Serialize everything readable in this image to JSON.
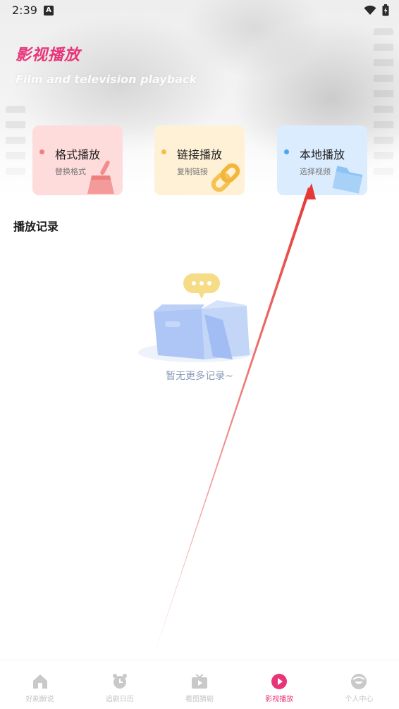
{
  "status_bar": {
    "time": "2:39",
    "notification_icon": "a-letter-icon",
    "wifi_icon": "wifi-icon",
    "battery_icon": "battery-charging-icon"
  },
  "header": {
    "title": "影视播放",
    "subtitle": "Film and television playback",
    "title_color": "#e8357a"
  },
  "cards": [
    {
      "title": "格式播放",
      "subtitle": "替换格式",
      "icon": "broom-icon",
      "bg": "#ffdcdc",
      "accent": "#f07f7f"
    },
    {
      "title": "链接播放",
      "subtitle": "复制链接",
      "icon": "chain-link-icon",
      "bg": "#fff1d6",
      "accent": "#f3bf4a"
    },
    {
      "title": "本地播放",
      "subtitle": "选择视频",
      "icon": "folder-icon",
      "bg": "#dcecff",
      "accent": "#49a6ee"
    }
  ],
  "history": {
    "title": "播放记录",
    "empty_text": "暂无更多记录~"
  },
  "bottom_nav": {
    "active_color": "#e8357a",
    "items": [
      {
        "label": "好剧解说",
        "icon": "home-icon",
        "active": false
      },
      {
        "label": "追剧日历",
        "icon": "alarm-clock-icon",
        "active": false
      },
      {
        "label": "看图猜剧",
        "icon": "tv-play-icon",
        "active": false
      },
      {
        "label": "影视播放",
        "icon": "play-circle-icon",
        "active": true
      },
      {
        "label": "个人中心",
        "icon": "face-icon",
        "active": false
      }
    ]
  }
}
